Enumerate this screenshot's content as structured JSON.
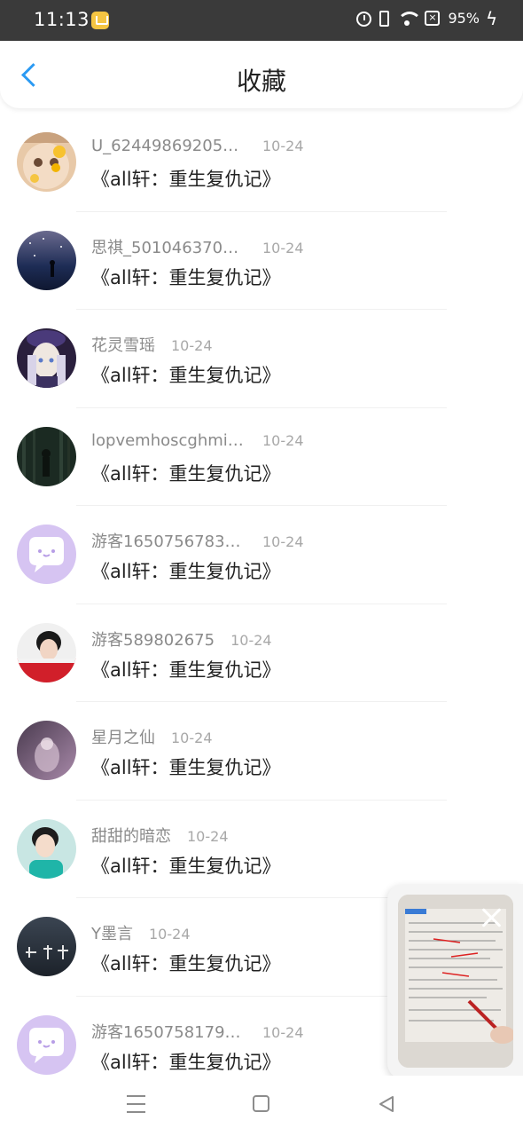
{
  "status_bar": {
    "time": "11:13",
    "battery": "95%",
    "icons": [
      "app-notification-icon",
      "alarm-icon",
      "vibrate-icon",
      "wifi-icon",
      "sim-icon",
      "charging-icon"
    ]
  },
  "header": {
    "title": "收藏",
    "back_icon": "chevron-left-icon",
    "accent_color": "#2b9af3"
  },
  "items": [
    {
      "user": "U_624498692051...",
      "date": "10-24",
      "title": "《all轩：重生复仇记》",
      "avatar": "girl-with-flowers"
    },
    {
      "user": "思祺_5010463705...",
      "date": "10-24",
      "title": "《all轩：重生复仇记》",
      "avatar": "night-sky"
    },
    {
      "user": "花灵雪瑶",
      "date": "10-24",
      "title": "《all轩：重生复仇记》",
      "avatar": "anime-girl"
    },
    {
      "user": "lopvemhoscghmino",
      "date": "10-24",
      "title": "《all轩：重生复仇记》",
      "avatar": "dark-forest"
    },
    {
      "user": "游客16507567830...",
      "date": "10-24",
      "title": "《all轩：重生复仇记》",
      "avatar": "default-purple"
    },
    {
      "user": "游客589802675",
      "date": "10-24",
      "title": "《all轩：重生复仇记》",
      "avatar": "portrait-red"
    },
    {
      "user": "星月之仙",
      "date": "10-24",
      "title": "《all轩：重生复仇记》",
      "avatar": "purple-art"
    },
    {
      "user": "甜甜的暗恋",
      "date": "10-24",
      "title": "《all轩：重生复仇记》",
      "avatar": "boy-teal"
    },
    {
      "user": "Y墨言",
      "date": "10-24",
      "title": "《all轩：重生复仇记》",
      "avatar": "night-text"
    },
    {
      "user": "游客16507581793...",
      "date": "10-24",
      "title": "《all轩：重生复仇记》",
      "avatar": "default-purple"
    }
  ],
  "floating_window": {
    "content": "homework-video-thumbnail",
    "close_icon": "close-icon"
  },
  "nav_bar": {
    "icons": [
      "menu-icon",
      "home-icon",
      "back-triangle-icon"
    ]
  }
}
